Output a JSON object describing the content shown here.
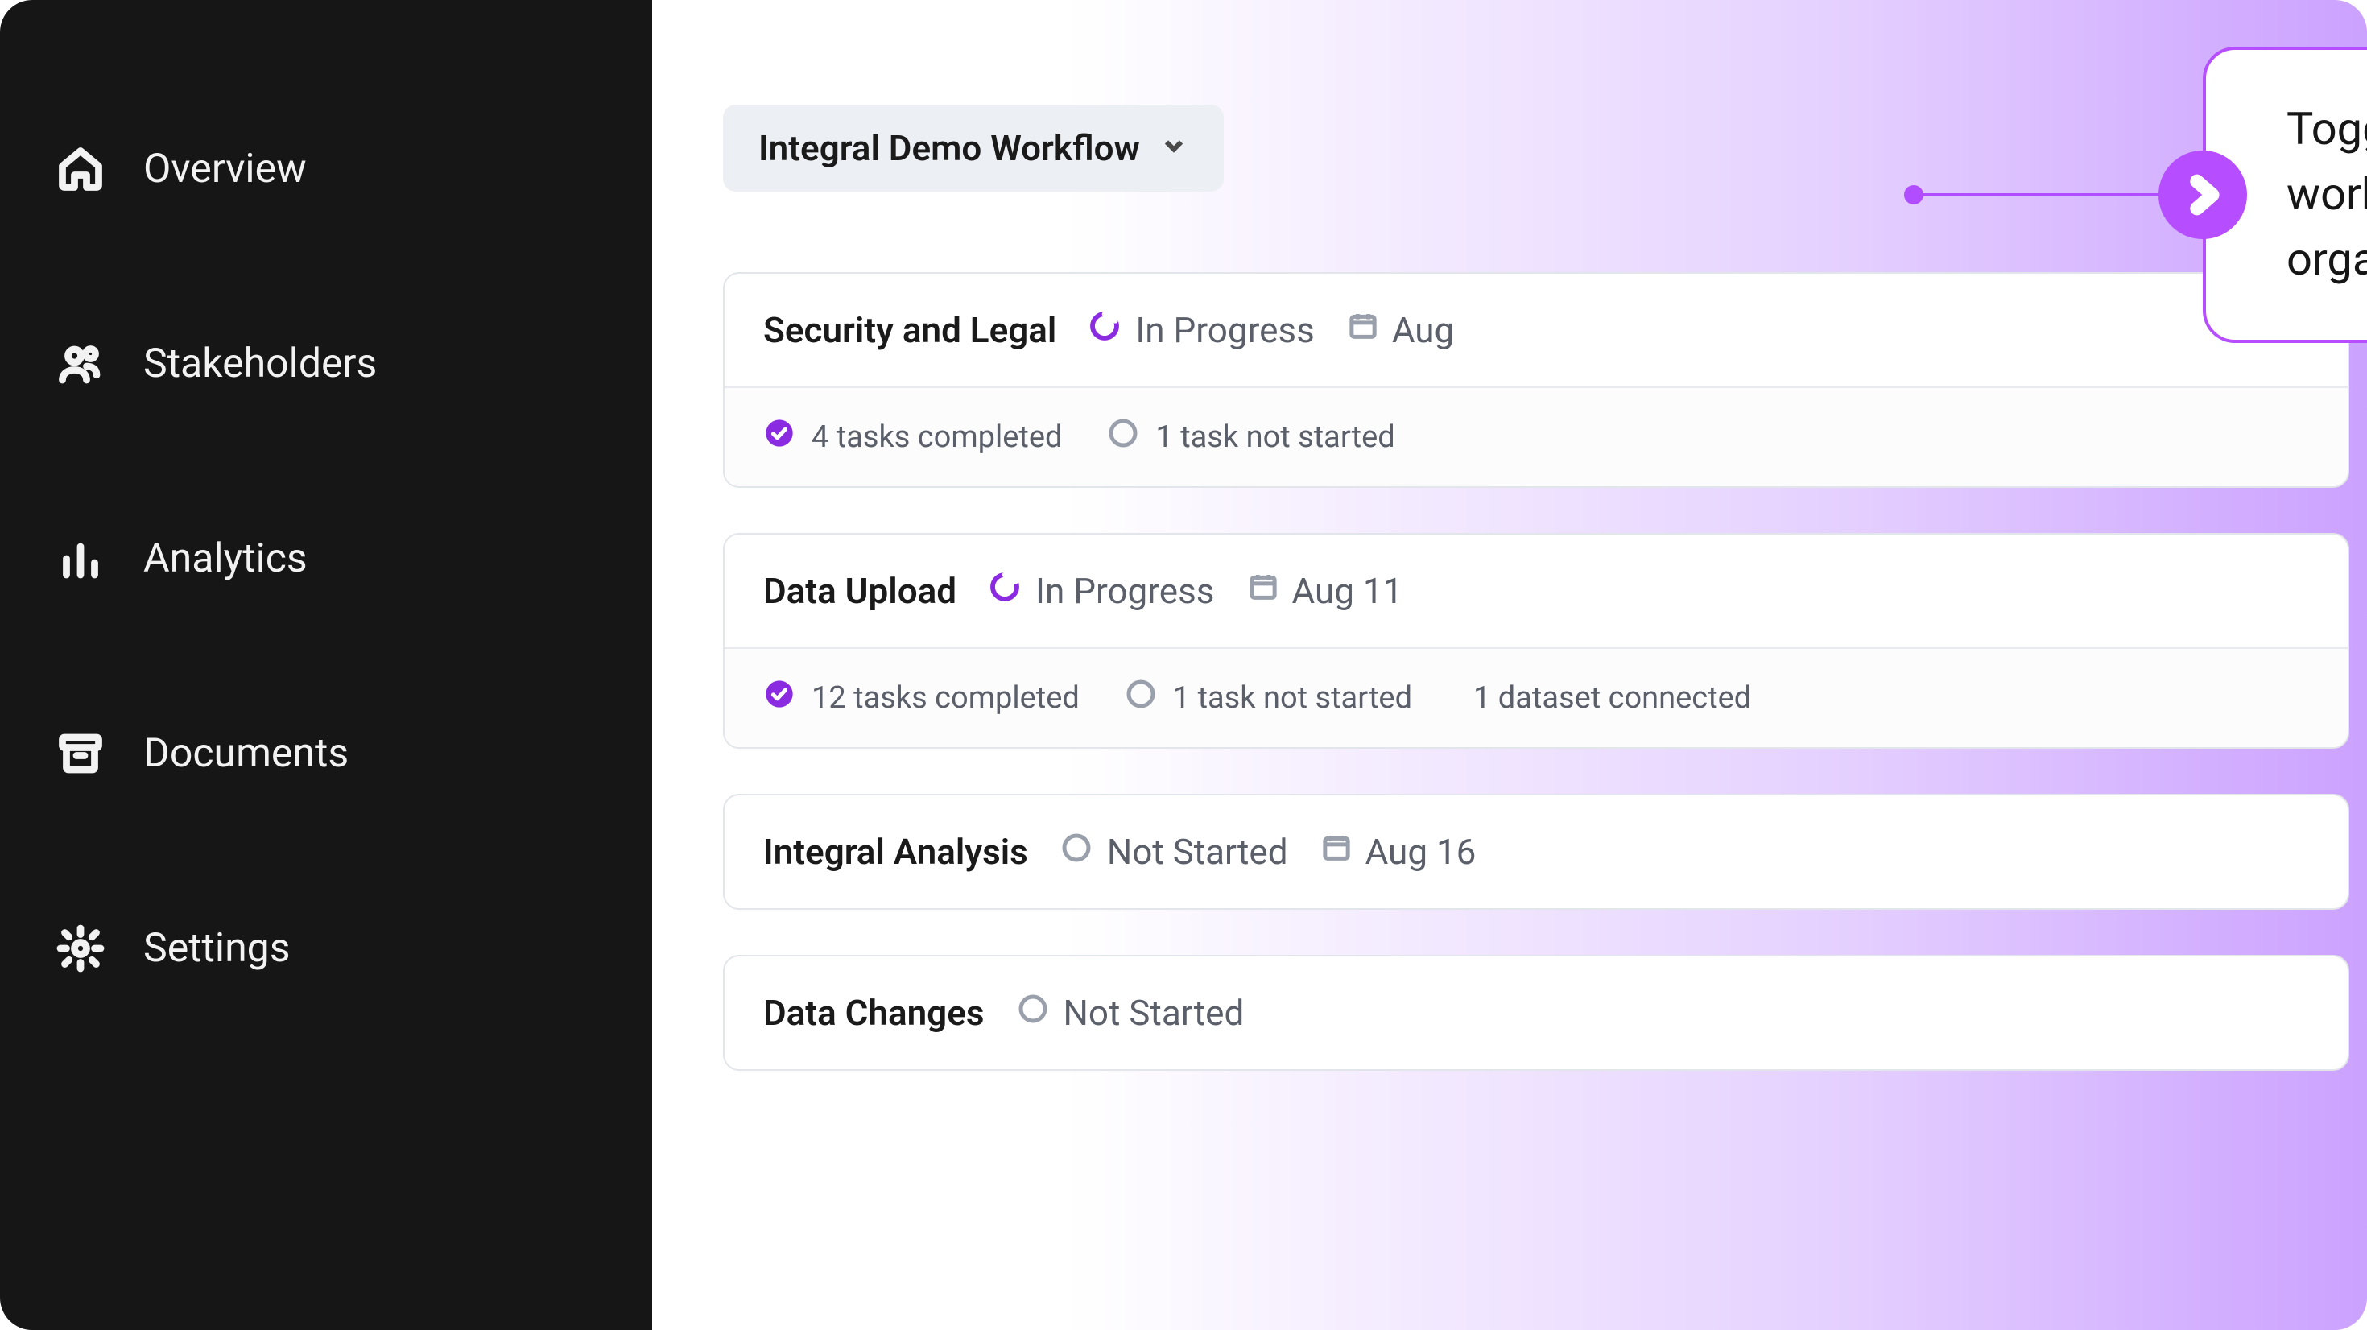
{
  "sidebar": {
    "items": [
      {
        "label": "Overview"
      },
      {
        "label": "Stakeholders"
      },
      {
        "label": "Analytics"
      },
      {
        "label": "Documents"
      },
      {
        "label": "Settings"
      }
    ]
  },
  "workflow": {
    "selected": "Integral Demo Workflow"
  },
  "callout": {
    "text": "Toggle between active workflows your organization is a part of"
  },
  "cards": [
    {
      "title": "Security and Legal",
      "status": "In Progress",
      "status_kind": "progress",
      "date": "Aug",
      "sub": [
        {
          "icon": "check",
          "text": "4 tasks completed"
        },
        {
          "icon": "empty",
          "text": "1 task not started"
        }
      ]
    },
    {
      "title": "Data Upload",
      "status": "In Progress",
      "status_kind": "progress",
      "date": "Aug 11",
      "sub": [
        {
          "icon": "check",
          "text": "12 tasks completed"
        },
        {
          "icon": "empty",
          "text": "1 task not started"
        },
        {
          "icon": "green",
          "text": "1 dataset connected"
        }
      ]
    },
    {
      "title": "Integral Analysis",
      "status": "Not Started",
      "status_kind": "notstarted",
      "date": "Aug 16",
      "sub": []
    },
    {
      "title": "Data Changes",
      "status": "Not Started",
      "status_kind": "notstarted",
      "date": "",
      "sub": []
    }
  ],
  "colors": {
    "accent": "#8a2be2",
    "progress": "#8a2be2",
    "green": "#14a36a"
  }
}
